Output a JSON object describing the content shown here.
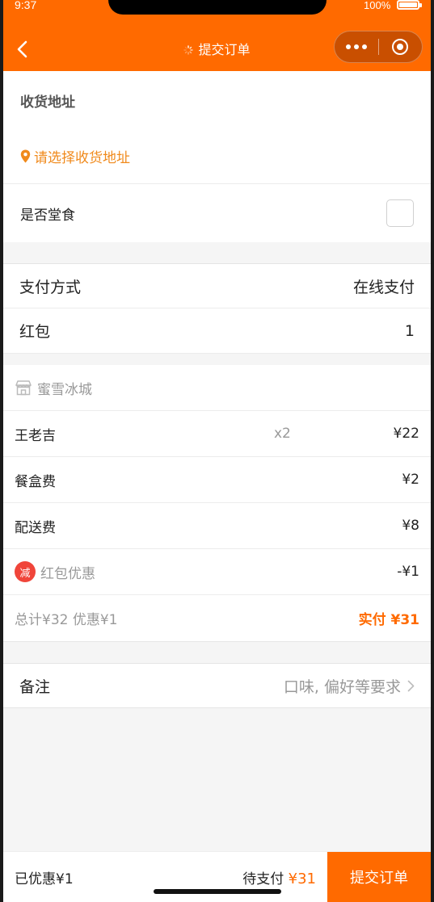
{
  "status_bar": {
    "time": "9:37",
    "battery": "100%"
  },
  "nav": {
    "title": "提交订单"
  },
  "address": {
    "heading": "收货地址",
    "placeholder": "请选择收货地址"
  },
  "dine_in": {
    "label": "是否堂食",
    "checked": false
  },
  "payment": {
    "method_label": "支付方式",
    "method_value": "在线支付",
    "redpacket_label": "红包",
    "redpacket_value": "1"
  },
  "order": {
    "shop_name": "蜜雪冰城",
    "items": [
      {
        "name": "王老吉",
        "qty": "x2",
        "price": "¥22"
      }
    ],
    "box_fee_label": "餐盒费",
    "box_fee": "¥2",
    "delivery_fee_label": "配送费",
    "delivery_fee": "¥8",
    "discount_badge": "减",
    "discount_label": "红包优惠",
    "discount_value": "-¥1",
    "summary_left": "总计¥32 优惠¥1",
    "summary_right": "实付 ¥31"
  },
  "note": {
    "label": "备注",
    "hint": "口味, 偏好等要求"
  },
  "bottom": {
    "saved": "已优惠¥1",
    "pending_label": "待支付",
    "pending_amount": "¥31",
    "submit_label": "提交订单"
  },
  "colors": {
    "accent": "#ff6a00",
    "address_link": "#f08a1c",
    "discount_badge": "#f0453a"
  }
}
